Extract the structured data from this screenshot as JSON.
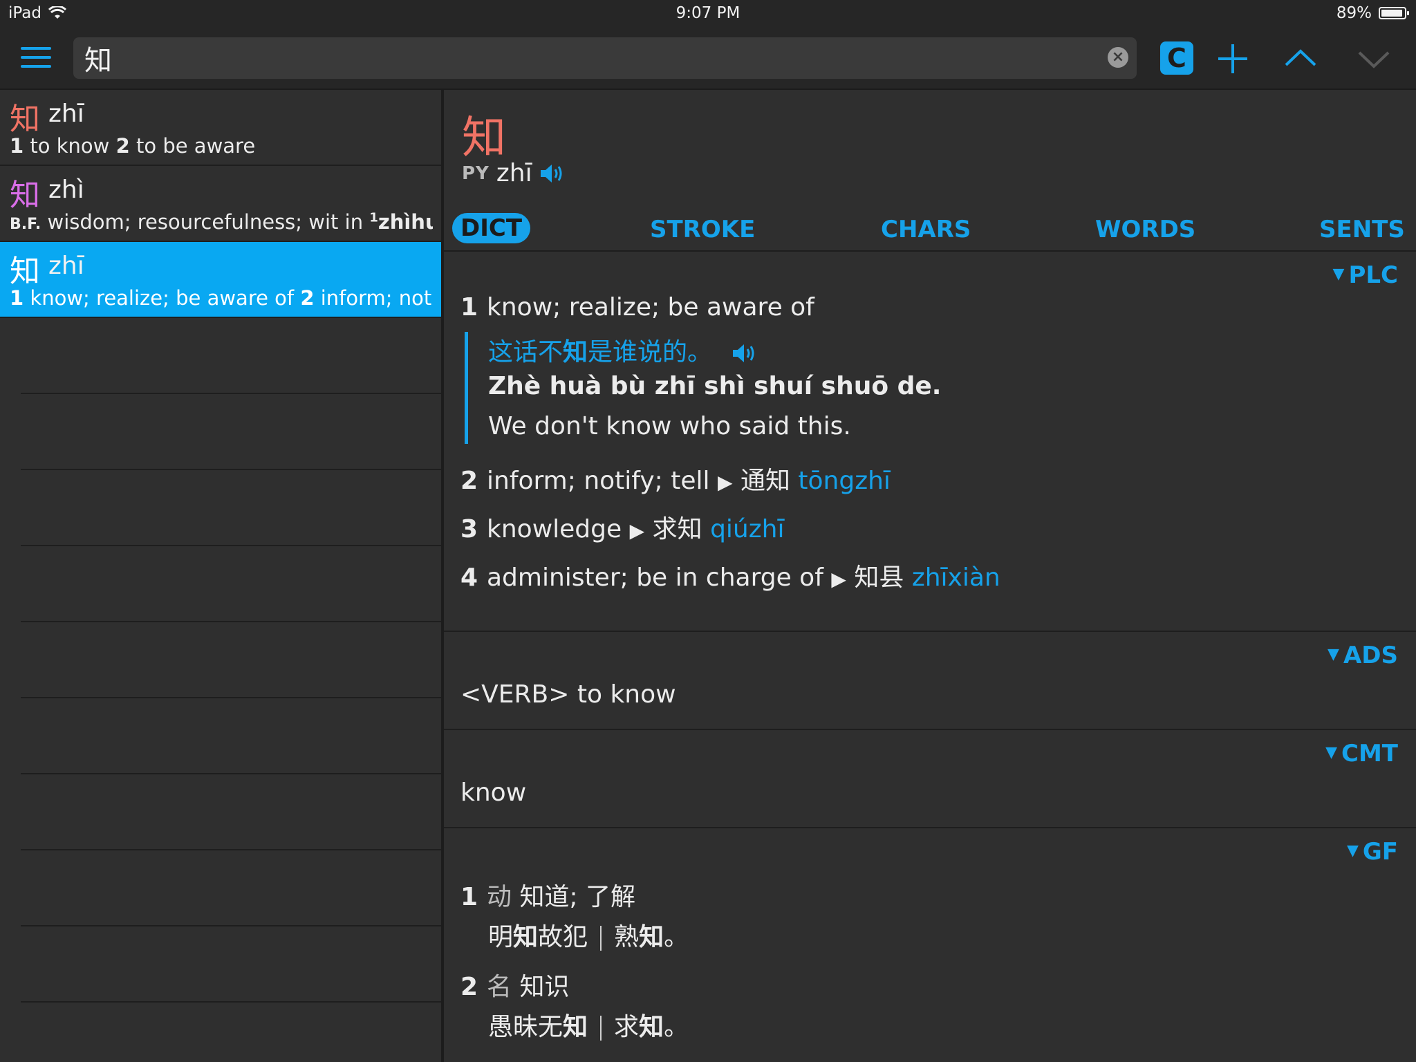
{
  "status": {
    "device": "iPad",
    "time": "9:07 PM",
    "battery": "89%"
  },
  "search": {
    "value": "知"
  },
  "toolbar": {
    "c_label": "C"
  },
  "results": [
    {
      "hanzi": "知",
      "pinyin": "zhī",
      "color": "#f17365",
      "gloss": [
        {
          "n": "1",
          "t": " to know  "
        },
        {
          "n": "2",
          "t": " to be aware"
        }
      ]
    },
    {
      "hanzi": "知",
      "pinyin": "zhì",
      "color": "#d96ee8",
      "gloss_pre": "B.F.",
      "gloss_text": " wisdom; resourcefulness; wit in ",
      "gloss_sup": "1",
      "gloss_post": "zhìhuì S"
    },
    {
      "hanzi": "知",
      "pinyin": "zhī",
      "color": "#ffffff",
      "gloss": [
        {
          "n": "1",
          "t": " know; realize; be aware of  "
        },
        {
          "n": "2",
          "t": " inform; notif…"
        }
      ]
    }
  ],
  "detail": {
    "hanzi": "知",
    "py_label": "PY",
    "pinyin": "zhī",
    "tabs": [
      "DICT",
      "STROKE",
      "CHARS",
      "WORDS",
      "SENTS"
    ],
    "plc": {
      "label": "PLC",
      "senses": [
        {
          "n": "1",
          "text": "know; realize; be aware of"
        },
        {
          "n": "2",
          "text": "inform; notify; tell",
          "hz": "通知",
          "py": "tōngzhī"
        },
        {
          "n": "3",
          "text": "knowledge",
          "hz": "求知",
          "py": "qiúzhī"
        },
        {
          "n": "4",
          "text": "administer; be in charge of",
          "hz": "知县",
          "py": "zhīxiàn"
        }
      ],
      "example": {
        "hz_a": "这话不",
        "hz_b": "知",
        "hz_c": "是谁说的。",
        "py_a": "Zhè huà bù ",
        "py_b": "zhī",
        "py_c": " shì shuí shuō de.",
        "en": "We don't know who said this."
      }
    },
    "ads": {
      "label": "ADS",
      "text": "<VERB> to know"
    },
    "cmt": {
      "label": "CMT",
      "text": "know"
    },
    "gf": {
      "label": "GF",
      "senses": [
        {
          "n": "1",
          "pos": "动",
          "def": "知道; 了解",
          "ex1a": "明",
          "ex1b": "知",
          "ex1c": "故犯",
          "ex2a": "熟",
          "ex2b": "知",
          "ex2c": "。"
        },
        {
          "n": "2",
          "pos": "名",
          "def": "知识",
          "ex1a": "愚昧无",
          "ex1b": "知",
          "ex1c": "",
          "ex2a": "求",
          "ex2b": "知",
          "ex2c": "。"
        }
      ]
    }
  },
  "colors": {
    "accent": "#16a2ea",
    "selected": "#09a8f2",
    "headword": "#f17365",
    "background": "#2f2f2f"
  }
}
